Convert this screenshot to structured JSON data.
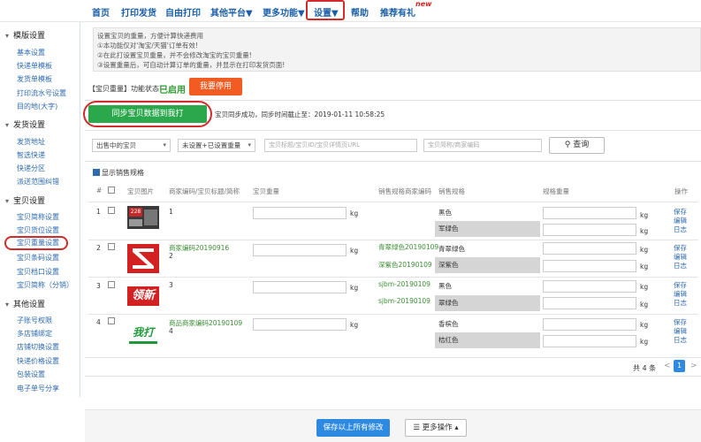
{
  "nav": {
    "items": [
      "首页",
      "打印发货",
      "自由打印",
      "其他平台▼",
      "更多功能▼",
      "设置▼",
      "帮助",
      "推荐有礼"
    ],
    "new_badge": "new"
  },
  "sidebar": {
    "groups": [
      {
        "title": "模版设置",
        "items": [
          "基本设置",
          "快递单模板",
          "发货单模板",
          "打印流水号设置",
          "目的地(大字)"
        ]
      },
      {
        "title": "发货设置",
        "items": [
          "发货地址",
          "智选快递",
          "快递分区",
          "派送范围纠错"
        ]
      },
      {
        "title": "宝贝设置",
        "items": [
          "宝贝简称设置",
          "宝贝货位设置",
          "宝贝重量设置",
          "宝贝条码设置",
          "宝贝档口设置",
          "宝贝简称（分销）"
        ]
      },
      {
        "title": "其他设置",
        "items": [
          "子账号权限",
          "多店铺绑定",
          "店铺切换设置",
          "快递价格设置",
          "包装设置",
          "电子单号分享"
        ]
      }
    ]
  },
  "notice": {
    "lines": [
      "设置宝贝的重量，方便计算快递费用",
      "①本功能仅对'淘宝/天猫'订单有效!",
      "②在此打设置宝贝重量，并不会修改淘宝的宝贝重量!",
      "③设置重量后，可自动计算订单的重量，并显示在打印发货页面!"
    ]
  },
  "status": {
    "label": "【宝贝重量】功能状态：",
    "value": "已启用",
    "disable_button": "我要停用"
  },
  "sync": {
    "button": "同步宝贝数据到我打",
    "result": "宝贝同步成功，同步时间截止至：2019-01-11 10:58:25"
  },
  "filters": {
    "status_select": "出售中的宝贝",
    "weight_select": "未设置+已设置重量",
    "keyword_placeholder": "宝贝标题/宝贝ID/宝贝详情页URL",
    "code_placeholder": "宝贝简称/商家编码",
    "search_button": "查询"
  },
  "show_spec_label": "显示销售规格",
  "table": {
    "headers": [
      "#",
      "宝贝图片",
      "商家编码/宝贝标题/简称",
      "宝贝重量",
      "销售规格商家编码",
      "销售规格",
      "规格重量",
      "操作"
    ],
    "unit": "kg",
    "ops": [
      "保存",
      "编辑",
      "日志"
    ],
    "rows": [
      {
        "index": "1",
        "code": "",
        "title": "1",
        "thumb_text": "228",
        "specs": [
          {
            "code": "",
            "name": "黑色"
          },
          {
            "code": "",
            "name": "军绿色"
          }
        ]
      },
      {
        "index": "2",
        "code": "商家编码20190916",
        "title": "2",
        "thumb_text": "",
        "specs": [
          {
            "code": "青翠绿色20190109",
            "name": "青翠绿色"
          },
          {
            "code": "深紫色20190109",
            "name": "深紫色"
          }
        ]
      },
      {
        "index": "3",
        "code": "",
        "title": "3",
        "thumb_text": "领新",
        "specs": [
          {
            "code": "sjbm-20190109",
            "name": "黑色"
          },
          {
            "code": "sjbm-20190109",
            "name": "翠绿色"
          }
        ]
      },
      {
        "index": "4",
        "code": "商品商家编码20190109",
        "title": "4",
        "thumb_text": "我打",
        "specs": [
          {
            "code": "",
            "name": "香槟色"
          },
          {
            "code": "",
            "name": "桔红色"
          }
        ]
      }
    ]
  },
  "pager": {
    "total": "共 4 条",
    "prev": "<",
    "page": "1",
    "next": ">"
  },
  "footer": {
    "save_button": "保存以上所有修改",
    "more_button": "☰ 更多操作 ▴"
  },
  "colors": {
    "accent": "#2d8ae0",
    "green": "#2ca84c",
    "orange": "#f25c22",
    "highlight": "#d12b2b"
  }
}
